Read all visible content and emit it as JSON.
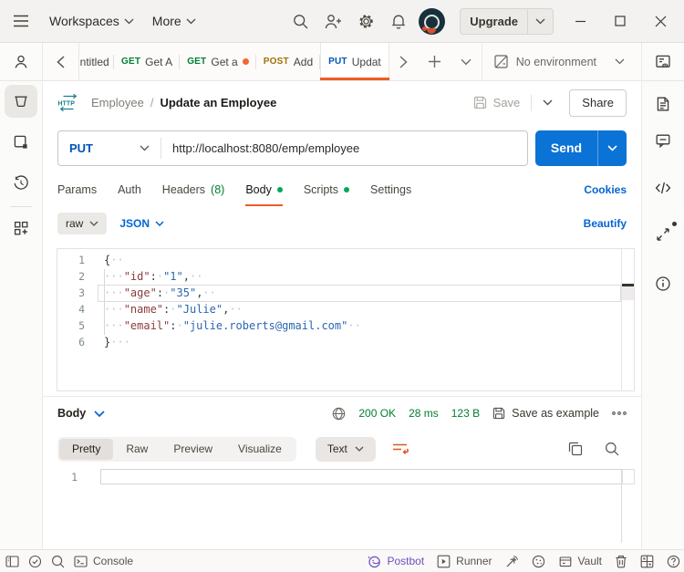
{
  "titlebar": {
    "workspaces_label": "Workspaces",
    "more_label": "More",
    "upgrade_label": "Upgrade"
  },
  "tabbar": {
    "tabs": [
      {
        "method": "",
        "label": "Untitled",
        "partial": true
      },
      {
        "method": "GET",
        "label": "Get A"
      },
      {
        "method": "GET",
        "label": "Get a",
        "dirty": true
      },
      {
        "method": "POST",
        "label": "Add"
      },
      {
        "method": "PUT",
        "label": "Updat",
        "active": true
      }
    ],
    "environment_label": "No environment"
  },
  "breadcrumb": {
    "collection": "Employee",
    "separator": "/",
    "request": "Update an Employee",
    "save_label": "Save",
    "share_label": "Share"
  },
  "request": {
    "method": "PUT",
    "url": "http://localhost:8080/emp/employee",
    "send_label": "Send",
    "tabs": [
      {
        "label": "Params"
      },
      {
        "label": "Auth"
      },
      {
        "label": "Headers",
        "count": "(8)"
      },
      {
        "label": "Body",
        "dot": true,
        "active": true
      },
      {
        "label": "Scripts",
        "dot": true
      },
      {
        "label": "Settings"
      }
    ],
    "cookies_label": "Cookies",
    "body_mode": "raw",
    "body_language": "JSON",
    "beautify_label": "Beautify"
  },
  "request_editor": {
    "lines": [
      {
        "num": "1",
        "tokens": [
          {
            "t": "{",
            "c": "pn"
          },
          {
            "t": "··",
            "c": "ws"
          }
        ]
      },
      {
        "num": "2",
        "tokens": [
          {
            "t": "···",
            "c": "ws"
          },
          {
            "t": "\"id\"",
            "c": "key"
          },
          {
            "t": ":",
            "c": "pn"
          },
          {
            "t": "·",
            "c": "ws"
          },
          {
            "t": "\"1\"",
            "c": "str"
          },
          {
            "t": ",",
            "c": "pn"
          },
          {
            "t": "··",
            "c": "ws"
          }
        ]
      },
      {
        "num": "3",
        "tokens": [
          {
            "t": "···",
            "c": "ws"
          },
          {
            "t": "\"age\"",
            "c": "key"
          },
          {
            "t": ":",
            "c": "pn"
          },
          {
            "t": "·",
            "c": "ws"
          },
          {
            "t": "\"35\"",
            "c": "str"
          },
          {
            "t": ",",
            "c": "pn"
          },
          {
            "t": "··",
            "c": "ws"
          }
        ],
        "current": true
      },
      {
        "num": "4",
        "tokens": [
          {
            "t": "···",
            "c": "ws"
          },
          {
            "t": "\"name\"",
            "c": "key"
          },
          {
            "t": ":",
            "c": "pn"
          },
          {
            "t": "·",
            "c": "ws"
          },
          {
            "t": "\"Julie\"",
            "c": "str"
          },
          {
            "t": ",",
            "c": "pn"
          },
          {
            "t": "··",
            "c": "ws"
          }
        ]
      },
      {
        "num": "5",
        "tokens": [
          {
            "t": "···",
            "c": "ws"
          },
          {
            "t": "\"email\"",
            "c": "key"
          },
          {
            "t": ":",
            "c": "pn"
          },
          {
            "t": "·",
            "c": "ws"
          },
          {
            "t": "\"julie.roberts@gmail.com\"",
            "c": "str"
          },
          {
            "t": "··",
            "c": "ws"
          }
        ]
      },
      {
        "num": "6",
        "tokens": [
          {
            "t": "}",
            "c": "pn"
          },
          {
            "t": "···",
            "c": "ws"
          }
        ]
      }
    ]
  },
  "response": {
    "body_select_label": "Body",
    "status": "200 OK",
    "time": "28 ms",
    "size": "123 B",
    "save_example_label": "Save as example",
    "view_tabs": [
      {
        "label": "Pretty",
        "active": true
      },
      {
        "label": "Raw"
      },
      {
        "label": "Preview"
      },
      {
        "label": "Visualize"
      }
    ],
    "format_label": "Text",
    "editor_line_number": "1"
  },
  "statusbar": {
    "left": [
      {
        "icon": "panel-toggle-icon"
      },
      {
        "icon": "check-circle-icon"
      },
      {
        "icon": "search-icon"
      },
      {
        "icon": "console-icon",
        "label": "Console"
      }
    ],
    "right": [
      {
        "icon": "postbot-icon",
        "label": "Postbot",
        "accent": true
      },
      {
        "icon": "runner-icon",
        "label": "Runner"
      },
      {
        "icon": "capture-icon"
      },
      {
        "icon": "cookie-icon"
      },
      {
        "icon": "vault-icon",
        "label": "Vault"
      },
      {
        "icon": "trash-icon"
      },
      {
        "icon": "split-pane-icon"
      },
      {
        "icon": "help-icon"
      }
    ]
  },
  "left_rail": [
    {
      "icon": "user-icon",
      "top": true
    },
    {
      "icon": "collections-icon",
      "selected": true
    },
    {
      "icon": "environments-icon"
    },
    {
      "icon": "history-icon"
    },
    {
      "divider": true
    },
    {
      "icon": "apps-add-icon"
    }
  ],
  "right_rail": [
    {
      "icon": "env-quicklook-icon",
      "top": true
    },
    {
      "icon": "documentation-icon"
    },
    {
      "icon": "comments-icon"
    },
    {
      "icon": "code-icon"
    },
    {
      "icon": "related-requests-icon",
      "notif": true
    },
    {
      "icon": "info-icon"
    }
  ],
  "colors": {
    "accent_orange": "#ef5b25",
    "primary_blue": "#0265d2",
    "send_blue": "#0b72d6",
    "method_get": "#007f31",
    "method_post": "#a07103",
    "method_put": "#0053b8",
    "status_green": "#007f31",
    "postbot_purple": "#6b4fbf"
  }
}
